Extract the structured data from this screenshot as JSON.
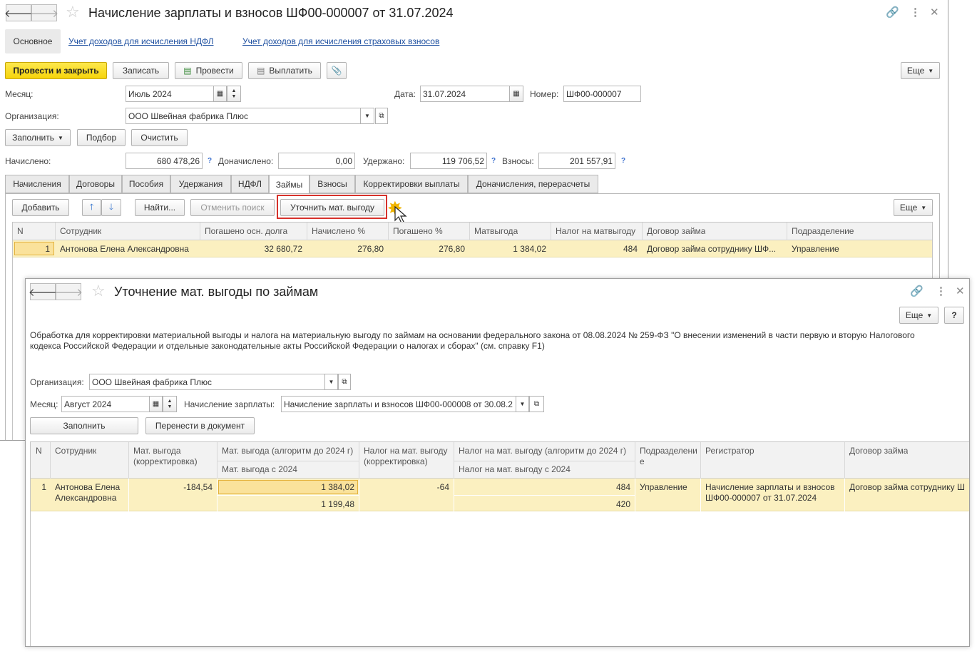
{
  "main": {
    "title": "Начисление зарплаты и взносов ШФ00-000007 от 31.07.2024",
    "nav_back": "🡐",
    "nav_forward": "🡒",
    "top_tabs": [
      "Основное",
      "Учет доходов для исчисления НДФЛ",
      "Учет доходов для исчисления страховых взносов"
    ],
    "toolbar": {
      "post_close": "Провести и закрыть",
      "save": "Записать",
      "post": "Провести",
      "pay": "Выплатить",
      "more": "Еще"
    },
    "month_label": "Месяц:",
    "month_value": "Июль 2024",
    "date_label": "Дата:",
    "date_value": "31.07.2024",
    "number_label": "Номер:",
    "number_value": "ШФ00-000007",
    "org_label": "Организация:",
    "org_value": "ООО Швейная фабрика Плюс",
    "fill_btn": "Заполнить",
    "select_btn": "Подбор",
    "clear_btn": "Очистить",
    "accrued_label": "Начислено:",
    "accrued_value": "680 478,26",
    "extra_label": "Доначислено:",
    "extra_value": "0,00",
    "withheld_label": "Удержано:",
    "withheld_value": "119 706,52",
    "contrib_label": "Взносы:",
    "contrib_value": "201 557,91",
    "help": "?",
    "tabs": [
      "Начисления",
      "Договоры",
      "Пособия",
      "Удержания",
      "НДФЛ",
      "Займы",
      "Взносы",
      "Корректировки выплаты",
      "Доначисления, перерасчеты"
    ],
    "active_tab": "Займы",
    "loans_toolbar": {
      "add": "Добавить",
      "find": "Найти...",
      "cancel_search": "Отменить поиск",
      "refine": "Уточнить мат. выгоду",
      "more": "Еще"
    },
    "table": {
      "headers": [
        "N",
        "Сотрудник",
        "Погашено осн. долга",
        "Начислено %",
        "Погашено %",
        "Матвыгода",
        "Налог на матвыгоду",
        "Договор займа",
        "Подразделение"
      ],
      "rows": [
        [
          "1",
          "Антонова Елена Александровна",
          "32 680,72",
          "276,80",
          "276,80",
          "1 384,02",
          "484",
          "Договор займа сотруднику ШФ...",
          "Управление"
        ]
      ]
    }
  },
  "dialog": {
    "title": "Уточнение мат. выгоды по займам",
    "more": "Еще",
    "help": "?",
    "description": "Обработка для корректировки материальной выгоды и налога на материальную выгоду по займам на основании федерального закона от 08.08.2024 № 259-ФЗ \"О внесении изменений в части первую и вторую Налогового кодекса Российской Федерации и отдельные законодательные акты Российской Федерации о налогах и сборах\" (см. справку F1)",
    "org_label": "Организация:",
    "org_value": "ООО Швейная фабрика Плюс",
    "month_label": "Месяц:",
    "month_value": "Август 2024",
    "payroll_label": "Начисление зарплаты:",
    "payroll_value": "Начисление зарплаты и взносов ШФ00-000008 от 30.08.2",
    "fill_btn": "Заполнить",
    "transfer_btn": "Перенести в документ",
    "table": {
      "h_n": "N",
      "h_emp": "Сотрудник",
      "h_mv_corr": "Мат. выгода (корректировка)",
      "h_mv_old": "Мат. выгода (алгоритм до 2024 г)",
      "h_mv_new": "Мат. выгода с 2024",
      "h_tax_corr": "Налог на мат. выгоду (корректировка)",
      "h_tax_old": "Налог на мат. выгоду (алгоритм до 2024 г)",
      "h_tax_new": "Налог на мат. выгоду с 2024",
      "h_div": "Подразделение",
      "h_reg": "Регистратор",
      "h_contract": "Договор займа",
      "row": {
        "n": "1",
        "emp": "Антонова Елена Александровна",
        "mv_corr": "-184,54",
        "mv_old": "1 384,02",
        "mv_new": "1 199,48",
        "tax_corr": "-64",
        "tax_old": "484",
        "tax_new": "420",
        "div": "Управление",
        "reg": "Начисление зарплаты и взносов ШФ00-000007 от 31.07.2024",
        "contract": "Договор займа сотруднику Ш"
      }
    }
  },
  "colors": {
    "accent_yellow": "#f6d40a",
    "selected_row": "#fbf0c0",
    "highlight": "#d6312b",
    "link": "#1d4fa0"
  }
}
